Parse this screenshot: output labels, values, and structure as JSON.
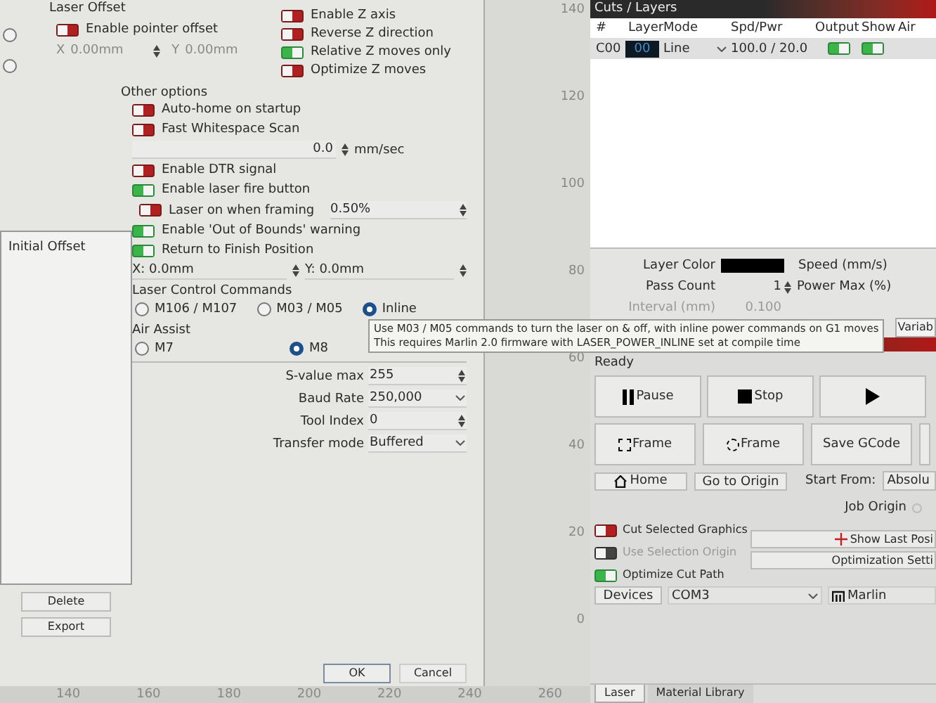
{
  "settings_dialog": {
    "side_radios": [
      {
        "selected": false
      },
      {
        "selected": false
      }
    ],
    "laser_offset": {
      "title": "Laser Offset",
      "pointer_offset": {
        "label": "Enable pointer offset",
        "on": false
      },
      "x_label": "X",
      "x_value": "0.00mm",
      "y_label": "Y",
      "y_value": "0.00mm"
    },
    "z_options": [
      {
        "label": "Enable Z axis",
        "on": false
      },
      {
        "label": "Reverse Z direction",
        "on": false
      },
      {
        "label": "Relative Z moves only",
        "on": true
      },
      {
        "label": "Optimize Z moves",
        "on": false
      }
    ],
    "profile_list": {
      "items": [
        "Initial Offset"
      ],
      "buttons": [
        "Delete",
        "Export"
      ]
    },
    "other_options": {
      "title": "Other options",
      "rows": [
        {
          "kind": "toggle",
          "label": "Auto-home on startup",
          "on": false
        },
        {
          "kind": "toggle",
          "label": "Fast Whitespace Scan",
          "on": false
        },
        {
          "kind": "spin",
          "value": "0.0",
          "unit": "mm/sec"
        },
        {
          "kind": "toggle",
          "label": "Enable DTR signal",
          "on": false
        },
        {
          "kind": "toggle",
          "label": "Enable laser fire button",
          "on": true
        },
        {
          "kind": "toggle_field",
          "label": "Laser on when framing",
          "on": false,
          "value": "0.50%"
        },
        {
          "kind": "toggle",
          "label": "Enable 'Out of Bounds' warning",
          "on": true
        },
        {
          "kind": "toggle",
          "label": "Return to Finish Position",
          "on": true
        },
        {
          "kind": "xy",
          "x": "X: 0.0mm",
          "y": "Y: 0.0mm"
        }
      ]
    },
    "laser_control": {
      "title": "Laser Control Commands",
      "options": [
        {
          "label": "M106 / M107",
          "selected": false
        },
        {
          "label": "M03 / M05",
          "selected": false
        },
        {
          "label": "Inline",
          "selected": true
        }
      ]
    },
    "air_assist": {
      "title": "Air Assist",
      "options": [
        {
          "label": "M7",
          "selected": false
        },
        {
          "label": "M8",
          "selected": true
        }
      ]
    },
    "fields": [
      {
        "label": "S-value max",
        "value": "255",
        "kind": "spin"
      },
      {
        "label": "Baud Rate",
        "value": "250,000",
        "kind": "select"
      },
      {
        "label": "Tool Index",
        "value": "0",
        "kind": "spin"
      },
      {
        "label": "Transfer mode",
        "value": "Buffered",
        "kind": "select"
      }
    ],
    "buttons": [
      "OK",
      "Cancel"
    ]
  },
  "tooltip": [
    "Use M03 / M05 commands to turn the laser on & off, with inline power commands on G1 moves",
    "This requires Marlin 2.0 firmware with LASER_POWER_INLINE set at compile time"
  ],
  "y_ruler": [
    "140",
    "120",
    "100",
    "80",
    "60",
    "40",
    "20",
    "0"
  ],
  "x_ruler": [
    "140",
    "160",
    "180",
    "200",
    "220",
    "240",
    "260"
  ],
  "cuts_layers": {
    "title": "Cuts / Layers",
    "columns": [
      "#",
      "Layer",
      "Mode",
      "Spd/Pwr",
      "Output",
      "Show",
      "Air"
    ],
    "rows": [
      {
        "number": "C00",
        "layer": "00",
        "mode": "Line",
        "spd_pwr": "100.0 / 20.0",
        "output": true,
        "show": true
      }
    ],
    "layer_color_label": "Layer Color",
    "speed_label": "Speed (mm/s)",
    "pass_count_label": "Pass Count",
    "pass_count": "1",
    "power_max_label": "Power Max (%)",
    "interval_label": "Interval (mm)",
    "interval": "0.100",
    "tab": "Variab"
  },
  "laser_panel": {
    "status": "Ready",
    "buttons_row1": [
      {
        "label": "Pause",
        "kind": "pause"
      },
      {
        "label": "Stop",
        "kind": "stop"
      },
      {
        "kind": "play"
      }
    ],
    "buttons_row2": [
      {
        "label": "Frame",
        "kind": "frame_rect"
      },
      {
        "label": "Frame",
        "kind": "frame_circle"
      },
      {
        "label": "Save GCode",
        "kind": "text"
      }
    ],
    "home": "Home",
    "go_to_origin": "Go to Origin",
    "start_from_label": "Start From:",
    "start_from": "Absolu",
    "job_origin_label": "Job Origin",
    "toggles": [
      {
        "label": "Cut Selected Graphics",
        "on": false,
        "disabled": false
      },
      {
        "label": "Use Selection Origin",
        "on": false,
        "disabled": true
      },
      {
        "label": "Optimize Cut Path",
        "on": true,
        "disabled": false
      }
    ],
    "show_last_position": "Show Last Posi",
    "optimization_settings": "Optimization Setti",
    "devices": "Devices",
    "port": "COM3",
    "firmware": "Marlin",
    "tabs": [
      {
        "label": "Laser",
        "selected": true
      },
      {
        "label": "Material Library",
        "selected": false
      }
    ]
  }
}
